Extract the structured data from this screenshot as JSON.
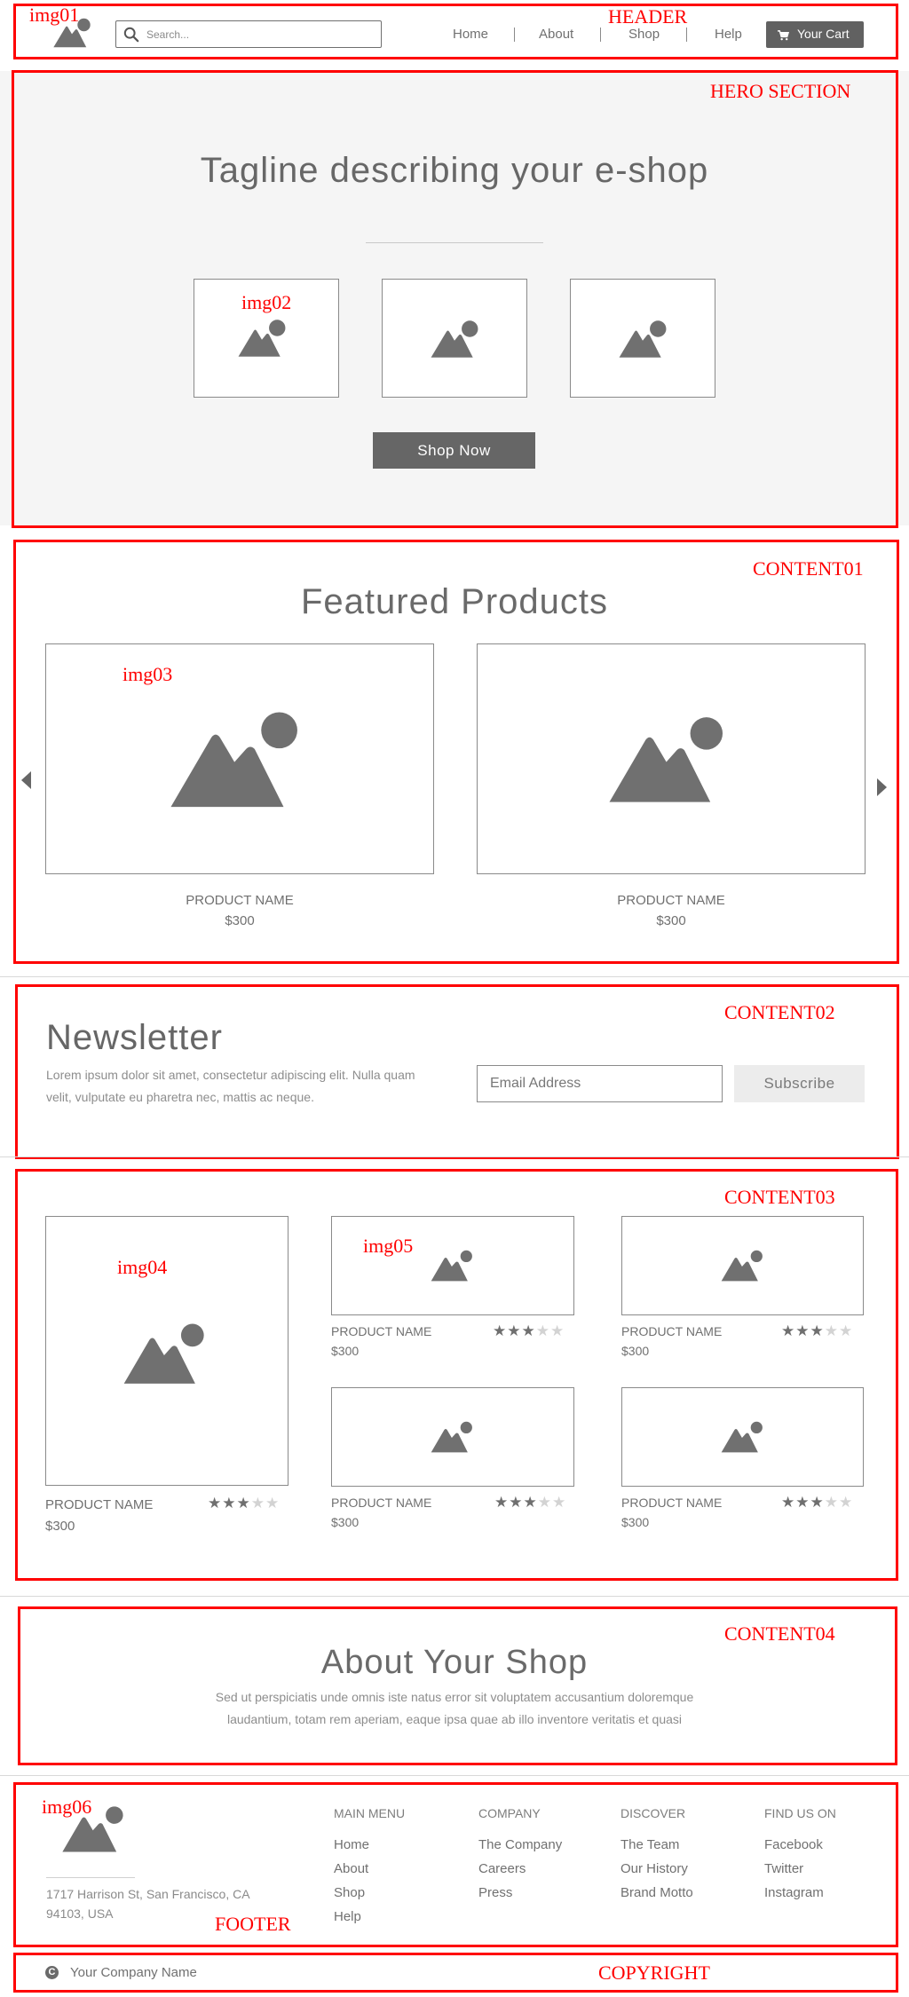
{
  "labels": {
    "header": "HEADER",
    "img01": "img01",
    "hero": "HERO SECTION",
    "img02": "img02",
    "content01": "CONTENT01",
    "img03": "img03",
    "content02": "CONTENT02",
    "content03": "CONTENT03",
    "img04": "img04",
    "img05": "img05",
    "content04": "CONTENT04",
    "img06": "img06",
    "footer": "FOOTER",
    "copyright": "COPYRIGHT"
  },
  "colors": {
    "annotation": "#ff0000",
    "placeholder_icon": "#707070",
    "primary_button": "#666666",
    "hero_background": "#f5f5f5"
  },
  "header": {
    "search_placeholder": "Search...",
    "search_icon": "search-icon",
    "nav": [
      "Home",
      "About",
      "Shop",
      "Help"
    ],
    "cart_label": "Your Cart",
    "cart_icon": "cart-icon"
  },
  "hero": {
    "tagline": "Tagline describing your e-shop",
    "cta": "Shop Now"
  },
  "featured": {
    "title": "Featured Products",
    "products": [
      {
        "name": "PRODUCT NAME",
        "price": "$300"
      },
      {
        "name": "PRODUCT NAME",
        "price": "$300"
      }
    ]
  },
  "newsletter": {
    "title": "Newsletter",
    "description": "Lorem ipsum dolor sit amet, consectetur adipiscing elit. Nulla quam velit, vulputate eu pharetra nec, mattis ac neque.",
    "email_placeholder": "Email Address",
    "subscribe": "Subscribe"
  },
  "grid": {
    "products": [
      {
        "name": "PRODUCT NAME",
        "price": "$300",
        "rating": 3,
        "max": 5
      },
      {
        "name": "PRODUCT NAME",
        "price": "$300",
        "rating": 3,
        "max": 5
      },
      {
        "name": "PRODUCT NAME",
        "price": "$300",
        "rating": 3,
        "max": 5
      },
      {
        "name": "PRODUCT NAME",
        "price": "$300",
        "rating": 3,
        "max": 5
      },
      {
        "name": "PRODUCT NAME",
        "price": "$300",
        "rating": 3,
        "max": 5
      }
    ]
  },
  "about": {
    "title": "About Your Shop",
    "text": "Sed ut perspiciatis unde omnis iste natus error sit voluptatem accusantium doloremque laudantium, totam rem aperiam, eaque ipsa quae ab illo inventore veritatis et quasi"
  },
  "footer": {
    "address": "1717 Harrison St, San Francisco, CA 94103, USA",
    "columns": [
      {
        "heading": "MAIN MENU",
        "links": [
          "Home",
          "About",
          "Shop",
          "Help"
        ]
      },
      {
        "heading": "COMPANY",
        "links": [
          "The Company",
          "Careers",
          "Press"
        ]
      },
      {
        "heading": "DISCOVER",
        "links": [
          "The Team",
          "Our History",
          "Brand Motto"
        ]
      },
      {
        "heading": "FIND US ON",
        "links": [
          "Facebook",
          "Twitter",
          "Instagram"
        ]
      }
    ]
  },
  "copyright": {
    "icon": "copyright-icon",
    "text": "Your Company Name"
  }
}
